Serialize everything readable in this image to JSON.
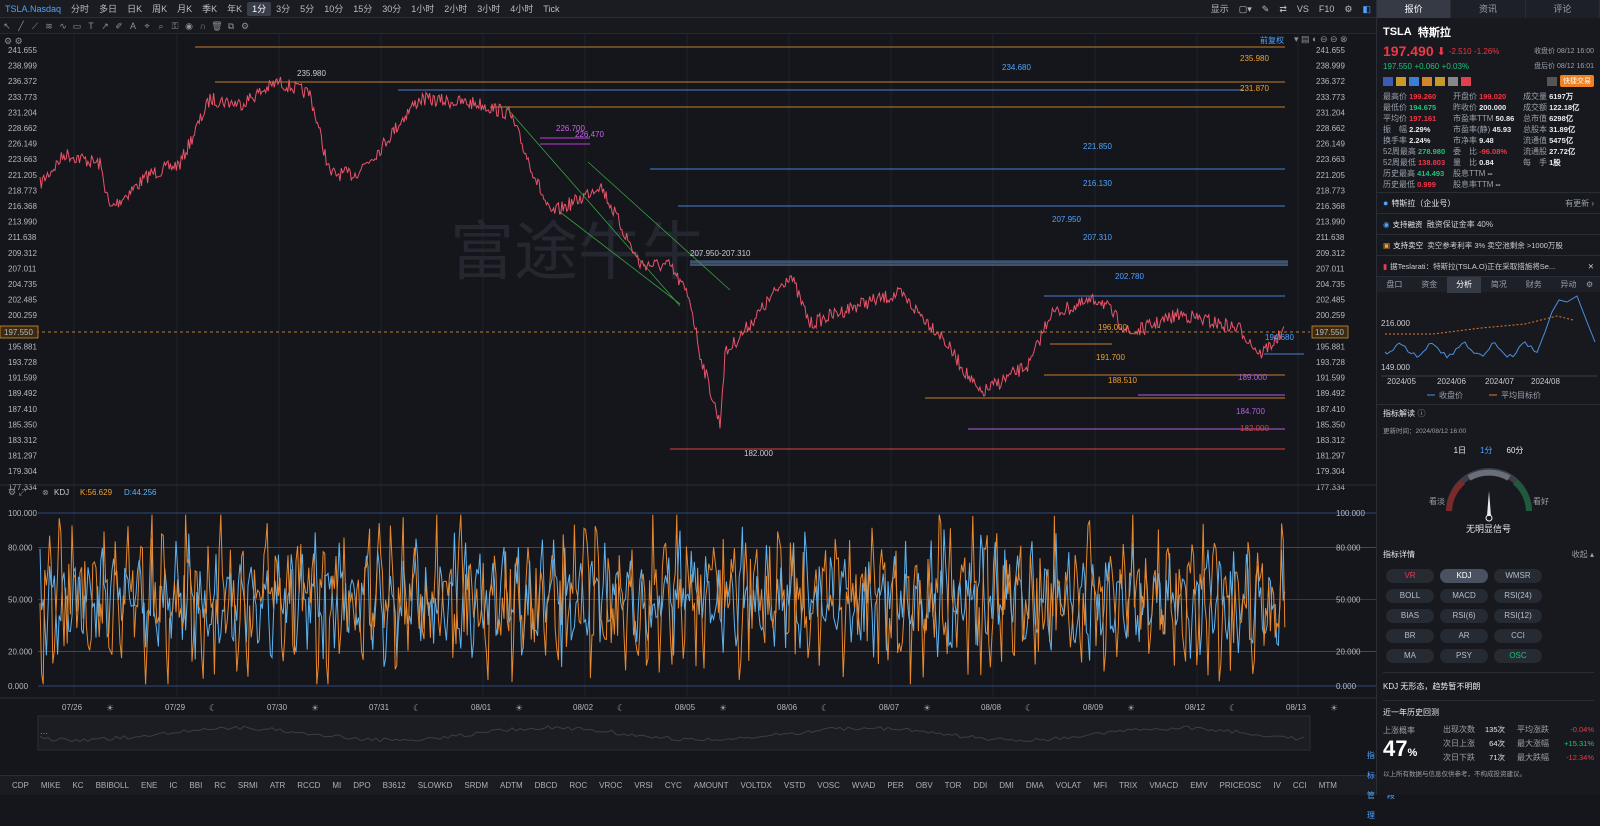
{
  "header": {
    "symbol": "TSLA.Nasdaq",
    "timeframes": [
      "分时",
      "多日",
      "日K",
      "周K",
      "月K",
      "季K",
      "年K",
      "1分",
      "3分",
      "5分",
      "10分",
      "15分",
      "30分",
      "1小时",
      "2小时",
      "3小时",
      "4小时",
      "Tick"
    ],
    "active_tf": "1分",
    "right_items": [
      "显示",
      "VS",
      "F10"
    ]
  },
  "chart": {
    "adjust_label": "前复权",
    "price_ticks": [
      "241.655",
      "238.999",
      "236.372",
      "233.773",
      "231.204",
      "228.662",
      "226.149",
      "223.663",
      "221.205",
      "218.773",
      "216.368",
      "213.990",
      "211.638",
      "209.312",
      "207.011",
      "204.735",
      "202.485",
      "200.259",
      "197.550",
      "195.881",
      "193.728",
      "191.599",
      "189.492",
      "187.410",
      "185.350",
      "183.312",
      "181.297",
      "179.304",
      "177.334"
    ],
    "current_price": "197.550",
    "annotations": [
      "235.980",
      "234.680",
      "231.870",
      "235.980",
      "226.700",
      "226.470",
      "221.850",
      "216.130",
      "207.950",
      "207.310",
      "207.950-207.310",
      "202.780",
      "196.000",
      "194.680",
      "191.700",
      "188.510",
      "189.000",
      "184.700",
      "182.000",
      "182.000"
    ],
    "watermark": "富途牛牛",
    "indicator": {
      "name": "KDJ",
      "k_label": "K:56.629",
      "d_label": "D:44.256",
      "levels": [
        "100.000",
        "80.000",
        "50.000",
        "20.000",
        "0.000"
      ]
    },
    "dates": [
      "07/26",
      "07/29",
      "07/30",
      "07/31",
      "08/01",
      "08/02",
      "08/05",
      "08/06",
      "08/07",
      "08/08",
      "08/09",
      "08/12",
      "08/13"
    ]
  },
  "bottom_indicators": [
    "CDP",
    "MIKE",
    "KC",
    "BBIBOLL",
    "ENE",
    "IC",
    "BBI",
    "RC",
    "SRMI",
    "ATR",
    "RCCD",
    "MI",
    "DPO",
    "B3612",
    "SLOWKD",
    "SRDM",
    "ADTM",
    "DBCD",
    "ROC",
    "VROC",
    "VRSI",
    "CYC",
    "AMOUNT",
    "VOLTDX",
    "VSTD",
    "VOSC",
    "WVAD",
    "PER",
    "OBV",
    "TOR",
    "DDI",
    "DMI",
    "DMA",
    "VOLAT",
    "MFI",
    "TRIX",
    "VMACD",
    "EMV",
    "PRICEOSC",
    "IV",
    "CCI",
    "MTM"
  ],
  "bottom_right": [
    "指标管理",
    "时段"
  ],
  "panel": {
    "tabs": [
      "报价",
      "资讯",
      "评论"
    ],
    "ticker": "TSLA",
    "name": "特斯拉",
    "price": "197.490",
    "change": "-2.510",
    "change_pct": "-1.26%",
    "after_price": "197.550",
    "after_change": "+0.060",
    "after_pct": "+0.03%",
    "time1": "收盘价 08/12 16:00",
    "time2": "盘后价 08/12 16:01",
    "fast_trade": "快捷交易",
    "stats": [
      [
        "最高价",
        "199.260",
        "开盘价",
        "199.020",
        "成交量",
        "6197万"
      ],
      [
        "最低价",
        "194.675",
        "昨收价",
        "200.000",
        "成交额",
        "122.18亿"
      ],
      [
        "平均价",
        "197.161",
        "市盈率TTM",
        "50.86",
        "总市值",
        "6298亿"
      ],
      [
        "振　幅",
        "2.29%",
        "市盈率(静)",
        "45.93",
        "总股本",
        "31.89亿"
      ],
      [
        "换手率",
        "2.24%",
        "市净率",
        "9.48",
        "流通值",
        "5475亿"
      ],
      [
        "52周最高",
        "278.980",
        "委　比",
        "-96.08%",
        "流通股",
        "27.72亿"
      ],
      [
        "52周最低",
        "138.803",
        "量　比",
        "0.84",
        "每　手",
        "1股"
      ],
      [
        "历史最高",
        "414.493",
        "股息TTM",
        "--",
        "",
        ""
      ],
      [
        "历史最低",
        "0.999",
        "股息率TTM",
        "--",
        "",
        ""
      ]
    ],
    "company": "特斯拉（企业号）",
    "company_update": "有更新",
    "margin1_label": "支持融资",
    "margin1_text": "融资保证金率 40%",
    "margin2_label": "支持卖空",
    "margin2_text": "卖空参考利率 3%  卖空池剩余 >1000万股",
    "news": "据Teslarati：特斯拉(TSLA.O)正在采取措施将Se...",
    "subtabs": [
      "盘口",
      "资金",
      "分析",
      "简况",
      "财务",
      "异动"
    ],
    "active_subtab": "分析",
    "mini_chart": {
      "y_ticks": [
        "216.000",
        "149.000"
      ],
      "x_ticks": [
        "2024/05",
        "2024/06",
        "2024/07",
        "2024/08"
      ],
      "legend": [
        "收盘价",
        "平均目标价"
      ]
    },
    "indicator_title": "指标解读",
    "update_time": "更新时间：2024/08/12 16:00",
    "periods": [
      "1日",
      "1分",
      "60分"
    ],
    "active_period": "1分",
    "gauge_left": "看淡",
    "gauge_right": "看好",
    "signal": "无明显信号",
    "detail_title": "指标详情",
    "collapse": "收起",
    "chips": [
      "VR",
      "KDJ",
      "WMSR",
      "BOLL",
      "MACD",
      "RSI(24)",
      "BIAS",
      "RSI(6)",
      "RSI(12)",
      "BR",
      "AR",
      "CCI",
      "MA",
      "PSY",
      "OSC"
    ],
    "active_chip": "KDJ",
    "kdj_text": "KDJ 无形态，趋势暂不明朗",
    "backtest_title": "近一年历史回测",
    "rise_label": "上涨概率",
    "rise_pct": "47",
    "bt": [
      [
        "出现次数",
        "135次",
        "平均涨跌",
        "-0.04%"
      ],
      [
        "次日上涨",
        "64次",
        "最大涨幅",
        "+15.31%"
      ],
      [
        "次日下跌",
        "71次",
        "最大跌幅",
        "-12.34%"
      ]
    ],
    "disclaimer": "以上所有数据与信息仅供参考，不构成投资建议。"
  }
}
